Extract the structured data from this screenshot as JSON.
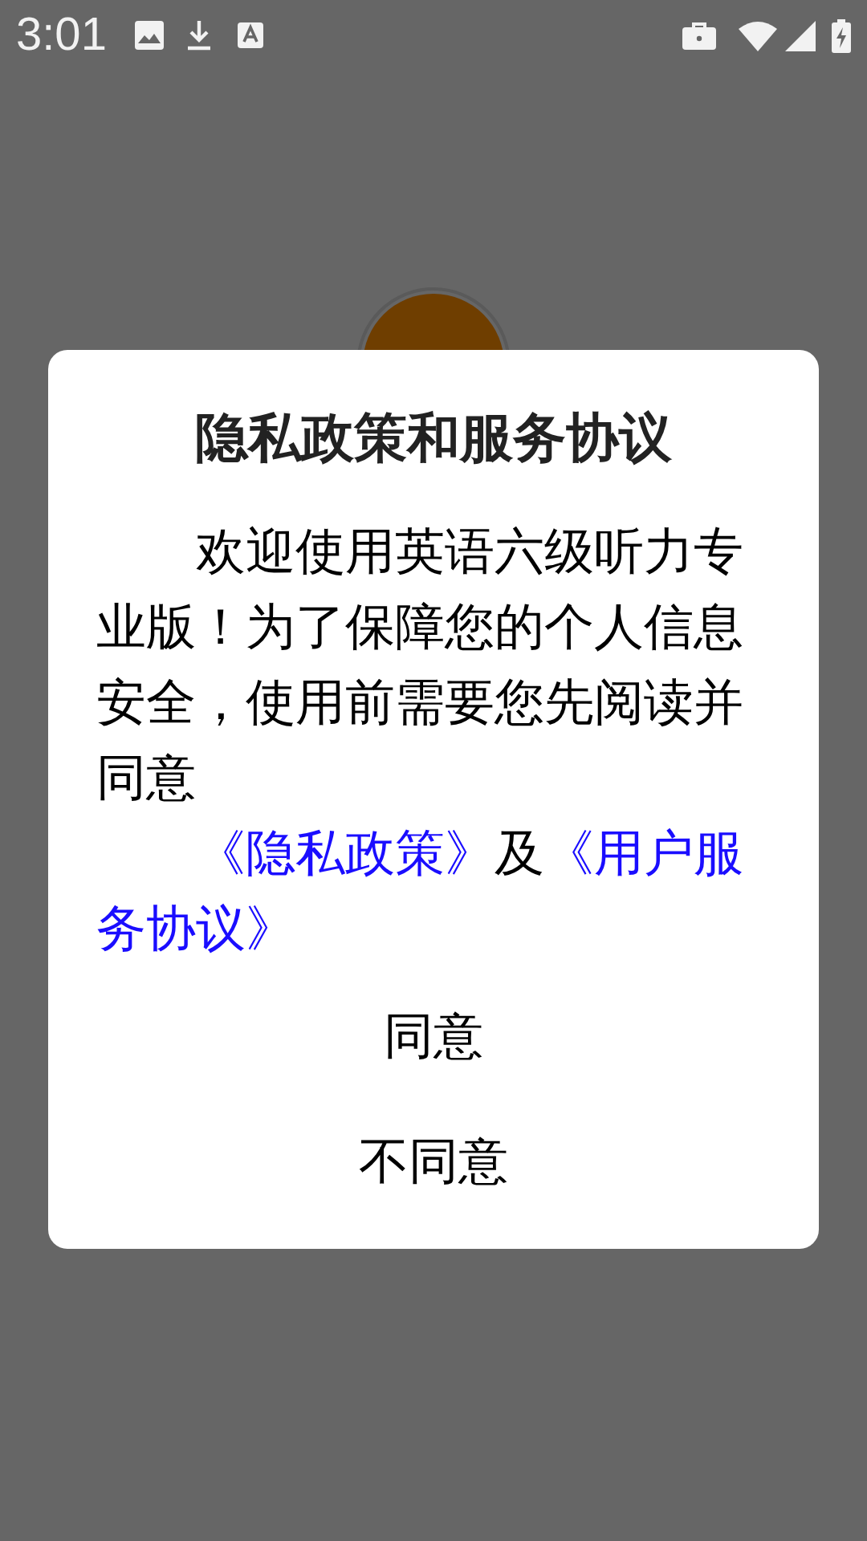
{
  "status_bar": {
    "time": "3:01"
  },
  "dialog": {
    "title": "隐私政策和服务协议",
    "message": "欢迎使用英语六级听力专业版！为了保障您的个人信息安全，使用前需要您先阅读并同意",
    "agreement": [
      {
        "kind": "link",
        "text": "《隐私政策》"
      },
      {
        "kind": "text",
        "text": "及"
      },
      {
        "kind": "link",
        "text": "《用户服务协议》"
      }
    ],
    "buttons": [
      "同意",
      "不同意"
    ]
  }
}
